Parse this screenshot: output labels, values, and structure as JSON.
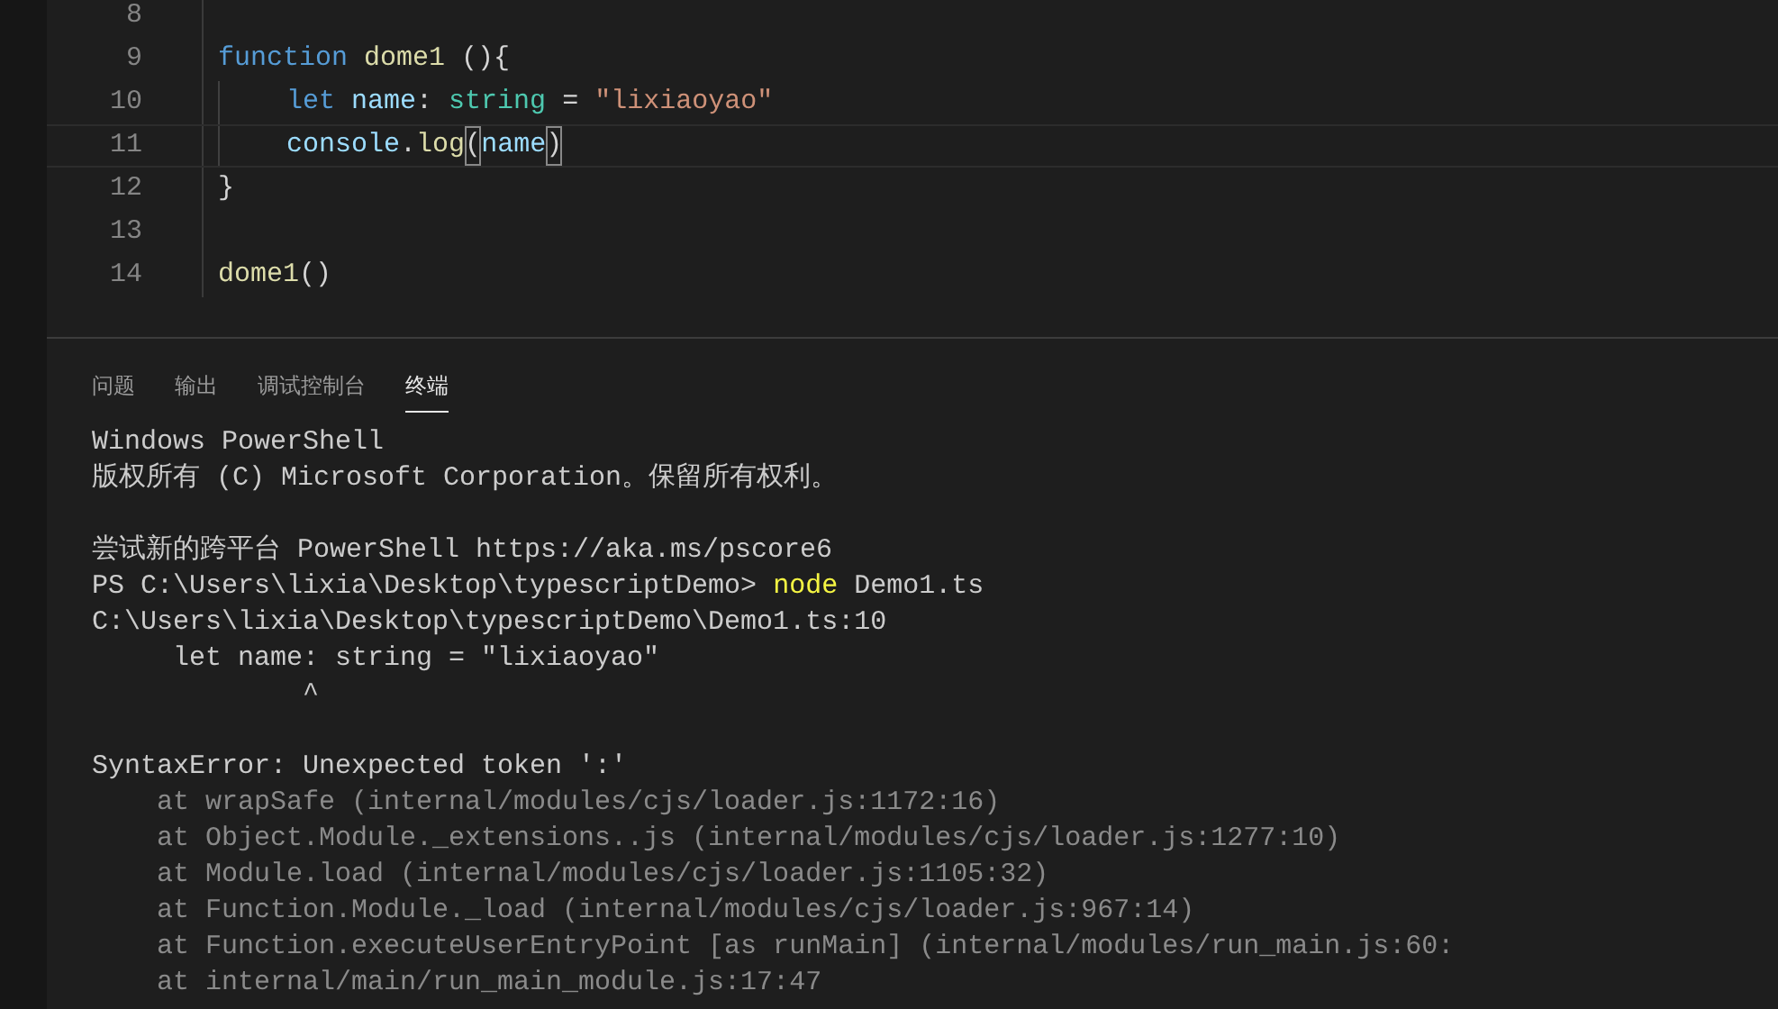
{
  "editor": {
    "lines": [
      {
        "number": "8",
        "current": false,
        "kind": "top"
      },
      {
        "number": "9",
        "current": false,
        "kind": "top",
        "tokens": [
          {
            "text": "function",
            "kind": "keyword"
          },
          {
            "text": " dome1",
            "kind": "function"
          },
          {
            "text": " (){",
            "kind": "plain"
          }
        ]
      },
      {
        "number": "10",
        "current": false,
        "kind": "indented",
        "tokens": [
          {
            "text": "let",
            "kind": "keyword"
          },
          {
            "text": " name",
            "kind": "variable"
          },
          {
            "text": ": ",
            "kind": "plain"
          },
          {
            "text": "string",
            "kind": "type"
          },
          {
            "text": " = ",
            "kind": "plain"
          },
          {
            "text": "\"lixiaoyao\"",
            "kind": "string"
          }
        ]
      },
      {
        "number": "11",
        "current": true,
        "kind": "indented",
        "tokens": [
          {
            "text": "console",
            "kind": "variable"
          },
          {
            "text": ".",
            "kind": "plain"
          },
          {
            "text": "log",
            "kind": "function"
          },
          {
            "text": "(",
            "kind": "bracket-match"
          },
          {
            "text": "name",
            "kind": "variable"
          },
          {
            "text": ")",
            "kind": "bracket-match"
          }
        ]
      },
      {
        "number": "12",
        "current": false,
        "kind": "top",
        "tokens": [
          {
            "text": "}",
            "kind": "plain"
          }
        ]
      },
      {
        "number": "13",
        "current": false,
        "kind": "top"
      },
      {
        "number": "14",
        "current": false,
        "kind": "top",
        "tokens": [
          {
            "text": "dome1",
            "kind": "function"
          },
          {
            "text": "()",
            "kind": "plain"
          }
        ]
      }
    ]
  },
  "panel": {
    "tabs": [
      {
        "label": "问题",
        "selected": false
      },
      {
        "label": "输出",
        "selected": false
      },
      {
        "label": "调试控制台",
        "selected": false
      },
      {
        "label": "终端",
        "selected": true
      }
    ],
    "terminal": [
      {
        "kind": "text",
        "text": "Windows PowerShell"
      },
      {
        "kind": "text",
        "text": "版权所有 (C) Microsoft Corporation。保留所有权利。"
      },
      {
        "kind": "blank"
      },
      {
        "kind": "text",
        "text": "尝试新的跨平台 PowerShell https://aka.ms/pscore6"
      },
      {
        "kind": "prompt",
        "text": "PS C:\\Users\\lixia\\Desktop\\typescriptDemo> ",
        "command": "node",
        "args": " Demo1.ts"
      },
      {
        "kind": "text",
        "text": "C:\\Users\\lixia\\Desktop\\typescriptDemo\\Demo1.ts:10"
      },
      {
        "kind": "text",
        "text": "     let name: string = \"lixiaoyao\""
      },
      {
        "kind": "text",
        "text": "             ^"
      },
      {
        "kind": "blank"
      },
      {
        "kind": "text",
        "text": "SyntaxError: Unexpected token ':'"
      },
      {
        "kind": "trace",
        "text": "    at wrapSafe (internal/modules/cjs/loader.js:1172:16)"
      },
      {
        "kind": "trace",
        "text": "    at Object.Module._extensions..js (internal/modules/cjs/loader.js:1277:10)"
      },
      {
        "kind": "trace",
        "text": "    at Module.load (internal/modules/cjs/loader.js:1105:32)"
      },
      {
        "kind": "trace",
        "text": "    at Function.Module._load (internal/modules/cjs/loader.js:967:14)"
      },
      {
        "kind": "trace",
        "text": "    at Function.executeUserEntryPoint [as runMain] (internal/modules/run_main.js:60:"
      },
      {
        "kind": "trace",
        "text": "    at internal/main/run_main_module.js:17:47"
      }
    ]
  }
}
